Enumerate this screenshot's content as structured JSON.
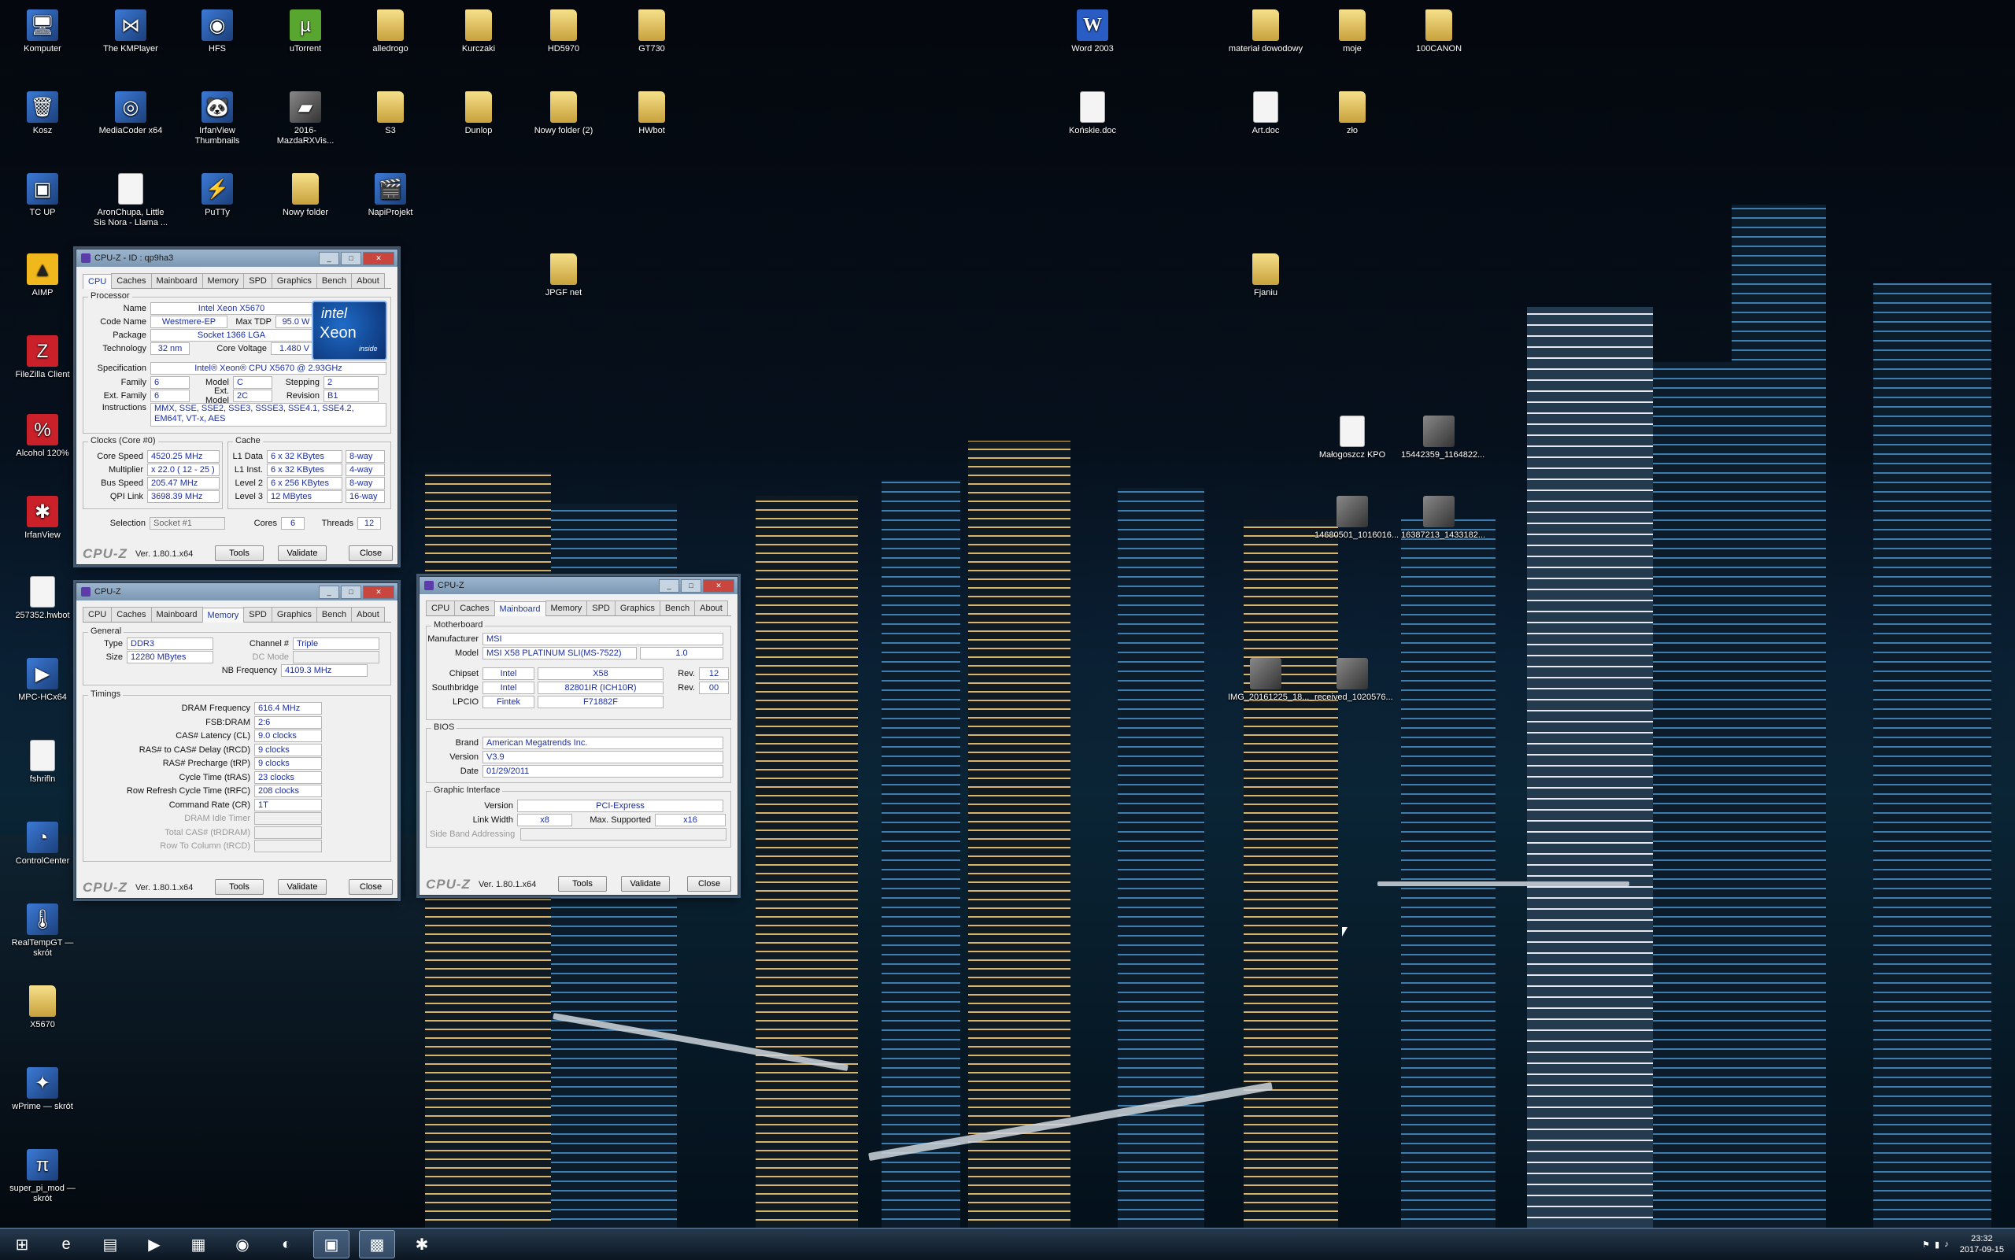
{
  "desktop_icons": [
    {
      "label": "Komputer",
      "icon": "computer-icon",
      "glyph": "🖥"
    },
    {
      "label": "The KMPlayer",
      "icon": "kmplayer-icon",
      "glyph": "⋈"
    },
    {
      "label": "HFS",
      "icon": "hfs-icon",
      "glyph": "◉"
    },
    {
      "label": "uTorrent",
      "icon": "utorrent-icon",
      "glyph": "µ"
    },
    {
      "label": "alledrogo",
      "icon": "folder-icon",
      "glyph": ""
    },
    {
      "label": "Kurczaki",
      "icon": "folder-icon",
      "glyph": ""
    },
    {
      "label": "HD5970",
      "icon": "folder-icon",
      "glyph": ""
    },
    {
      "label": "GT730",
      "icon": "folder-icon",
      "glyph": ""
    },
    {
      "label": "Word 2003",
      "icon": "word-icon",
      "glyph": "W"
    },
    {
      "label": "materiał dowodowy",
      "icon": "folder-icon",
      "glyph": ""
    },
    {
      "label": "moje",
      "icon": "folder-icon",
      "glyph": ""
    },
    {
      "label": "100CANON",
      "icon": "folder-icon",
      "glyph": ""
    },
    {
      "label": "Kosz",
      "icon": "recycle-bin-icon",
      "glyph": "🗑"
    },
    {
      "label": "MediaCoder x64",
      "icon": "mediacoder-icon",
      "glyph": "◎"
    },
    {
      "label": "IrfanView Thumbnails",
      "icon": "irfanview-thumbs-icon",
      "glyph": "🐼"
    },
    {
      "label": "2016-MazdaRXVis...",
      "icon": "image-icon",
      "glyph": "▰"
    },
    {
      "label": "S3",
      "icon": "folder-icon",
      "glyph": ""
    },
    {
      "label": "Dunlop",
      "icon": "folder-icon",
      "glyph": ""
    },
    {
      "label": "Nowy folder (2)",
      "icon": "folder-icon",
      "glyph": ""
    },
    {
      "label": "HWbot",
      "icon": "folder-icon",
      "glyph": ""
    },
    {
      "label": "Końskie.doc",
      "icon": "document-icon",
      "glyph": ""
    },
    {
      "label": "Art.doc",
      "icon": "document-icon",
      "glyph": ""
    },
    {
      "label": "zło",
      "icon": "folder-icon",
      "glyph": ""
    },
    {
      "label": "TC UP",
      "icon": "tcup-icon",
      "glyph": "▣"
    },
    {
      "label": "AronChupa, Little Sis Nora - Llama ...",
      "icon": "document-icon",
      "glyph": ""
    },
    {
      "label": "PuTTy",
      "icon": "putty-icon",
      "glyph": "⚡"
    },
    {
      "label": "Nowy folder",
      "icon": "folder-icon",
      "glyph": ""
    },
    {
      "label": "NapiProjekt",
      "icon": "napiprojekt-icon",
      "glyph": "🎬"
    },
    {
      "label": "AIMP",
      "icon": "aimp-icon",
      "glyph": "▲"
    },
    {
      "label": "JPGF net",
      "icon": "folder-icon",
      "glyph": ""
    },
    {
      "label": "Fjaniu",
      "icon": "folder-icon",
      "glyph": ""
    },
    {
      "label": "FileZilla Client",
      "icon": "filezilla-icon",
      "glyph": "Z"
    },
    {
      "label": "Alcohol 120%",
      "icon": "alcohol-icon",
      "glyph": "%"
    },
    {
      "label": "Małogoszcz KPO",
      "icon": "document-icon",
      "glyph": ""
    },
    {
      "label": "15442359_1164822...",
      "icon": "image-icon",
      "glyph": ""
    },
    {
      "label": "IrfanView",
      "icon": "irfanview-icon",
      "glyph": "✱"
    },
    {
      "label": "14680501_1016016...",
      "icon": "image-icon",
      "glyph": ""
    },
    {
      "label": "16387213_1433182...",
      "icon": "image-icon",
      "glyph": ""
    },
    {
      "label": "257352.hwbot",
      "icon": "document-icon",
      "glyph": ""
    },
    {
      "label": "MPC-HCx64",
      "icon": "mpchc-icon",
      "glyph": "▶"
    },
    {
      "label": "IMG_20161225_18...",
      "icon": "image-icon",
      "glyph": ""
    },
    {
      "label": "received_1020576...",
      "icon": "image-icon",
      "glyph": ""
    },
    {
      "label": "fshrifln",
      "icon": "document-icon",
      "glyph": ""
    },
    {
      "label": "ControlCenter",
      "icon": "controlcenter-icon",
      "glyph": "◔"
    },
    {
      "label": "RealTempGT — skrót",
      "icon": "realtemp-icon",
      "glyph": "🌡"
    },
    {
      "label": "X5670",
      "icon": "folder-icon",
      "glyph": ""
    },
    {
      "label": "wPrime — skrót",
      "icon": "wprime-icon",
      "glyph": "✦"
    },
    {
      "label": "super_pi_mod — skrót",
      "icon": "superpi-icon",
      "glyph": "π"
    }
  ],
  "cpu_window": {
    "title": "CPU-Z - ID : qp9ha3",
    "tabs": [
      "CPU",
      "Caches",
      "Mainboard",
      "Memory",
      "SPD",
      "Graphics",
      "Bench",
      "About"
    ],
    "processor_group": "Processor",
    "name_label": "Name",
    "name": "Intel Xeon X5670",
    "code_name_label": "Code Name",
    "code_name": "Westmere-EP",
    "max_tdp_label": "Max TDP",
    "max_tdp": "95.0 W",
    "package_label": "Package",
    "package": "Socket 1366 LGA",
    "technology_label": "Technology",
    "technology": "32 nm",
    "core_voltage_label": "Core Voltage",
    "core_voltage": "1.480 V",
    "specification_label": "Specification",
    "specification": "Intel® Xeon® CPU       X5670  @ 2.93GHz",
    "family_label": "Family",
    "family": "6",
    "model_label": "Model",
    "model": "C",
    "stepping_label": "Stepping",
    "stepping": "2",
    "ext_family_label": "Ext. Family",
    "ext_family": "6",
    "ext_model_label": "Ext. Model",
    "ext_model": "2C",
    "revision_label": "Revision",
    "revision": "B1",
    "instructions_label": "Instructions",
    "instructions": "MMX, SSE, SSE2, SSE3, SSSE3, SSE4.1, SSE4.2, EM64T, VT-x, AES",
    "clocks_group": "Clocks (Core #0)",
    "core_speed_label": "Core Speed",
    "core_speed": "4520.25 MHz",
    "multiplier_label": "Multiplier",
    "multiplier": "x 22.0 ( 12 - 25 )",
    "bus_speed_label": "Bus Speed",
    "bus_speed": "205.47 MHz",
    "qpi_link_label": "QPI Link",
    "qpi_link": "3698.39 MHz",
    "cache_group": "Cache",
    "l1d_label": "L1 Data",
    "l1d": "6 x 32 KBytes",
    "l1d_way": "8-way",
    "l1i_label": "L1 Inst.",
    "l1i": "6 x 32 KBytes",
    "l1i_way": "4-way",
    "l2_label": "Level 2",
    "l2": "6 x 256 KBytes",
    "l2_way": "8-way",
    "l3_label": "Level 3",
    "l3": "12 MBytes",
    "l3_way": "16-way",
    "selection_label": "Selection",
    "selection": "Socket #1",
    "cores_label": "Cores",
    "cores": "6",
    "threads_label": "Threads",
    "threads": "12",
    "badge_brand": "intel",
    "badge_product": "Xeon",
    "badge_inside": "inside"
  },
  "memory_window": {
    "title": "CPU-Z",
    "tabs": [
      "CPU",
      "Caches",
      "Mainboard",
      "Memory",
      "SPD",
      "Graphics",
      "Bench",
      "About"
    ],
    "general_group": "General",
    "type_label": "Type",
    "type": "DDR3",
    "channel_label": "Channel #",
    "channel": "Triple",
    "size_label": "Size",
    "size": "12280 MBytes",
    "dc_mode_label": "DC Mode",
    "dc_mode": "",
    "nb_freq_label": "NB Frequency",
    "nb_freq": "4109.3 MHz",
    "timings_group": "Timings",
    "timings": [
      {
        "label": "DRAM Frequency",
        "value": "616.4 MHz",
        "disabled": false
      },
      {
        "label": "FSB:DRAM",
        "value": "2:6",
        "disabled": false
      },
      {
        "label": "CAS# Latency (CL)",
        "value": "9.0 clocks",
        "disabled": false
      },
      {
        "label": "RAS# to CAS# Delay (tRCD)",
        "value": "9 clocks",
        "disabled": false
      },
      {
        "label": "RAS# Precharge (tRP)",
        "value": "9 clocks",
        "disabled": false
      },
      {
        "label": "Cycle Time (tRAS)",
        "value": "23 clocks",
        "disabled": false
      },
      {
        "label": "Row Refresh Cycle Time (tRFC)",
        "value": "208 clocks",
        "disabled": false
      },
      {
        "label": "Command Rate (CR)",
        "value": "1T",
        "disabled": false
      },
      {
        "label": "DRAM Idle Timer",
        "value": "",
        "disabled": true
      },
      {
        "label": "Total CAS# (tRDRAM)",
        "value": "",
        "disabled": true
      },
      {
        "label": "Row To Column (tRCD)",
        "value": "",
        "disabled": true
      }
    ]
  },
  "mainboard_window": {
    "title": "CPU-Z",
    "tabs": [
      "CPU",
      "Caches",
      "Mainboard",
      "Memory",
      "SPD",
      "Graphics",
      "Bench",
      "About"
    ],
    "motherboard_group": "Motherboard",
    "manufacturer_label": "Manufacturer",
    "manufacturer": "MSI",
    "model_label": "Model",
    "model": "MSI X58 PLATINUM SLI(MS-7522)",
    "model_rev": "1.0",
    "chipset_label": "Chipset",
    "chipset_vendor": "Intel",
    "chipset": "X58",
    "chipset_rev_label": "Rev.",
    "chipset_rev": "12",
    "southbridge_label": "Southbridge",
    "southbridge_vendor": "Intel",
    "southbridge": "82801IR (ICH10R)",
    "southbridge_rev_label": "Rev.",
    "southbridge_rev": "00",
    "lpcio_label": "LPCIO",
    "lpcio_vendor": "Fintek",
    "lpcio": "F71882F",
    "bios_group": "BIOS",
    "brand_label": "Brand",
    "brand": "American Megatrends Inc.",
    "version_label": "Version",
    "version": "V3.9",
    "date_label": "Date",
    "date": "01/29/2011",
    "graphic_group": "Graphic Interface",
    "gi_version_label": "Version",
    "gi_version": "PCI-Express",
    "link_width_label": "Link Width",
    "link_width": "x8",
    "max_supported_label": "Max. Supported",
    "max_supported": "x16",
    "side_band_label": "Side Band Addressing",
    "side_band": ""
  },
  "footer": {
    "brand": "CPU-Z",
    "version": "Ver. 1.80.1.x64",
    "tools": "Tools",
    "validate": "Validate",
    "close": "Close"
  },
  "taskbar": {
    "items": [
      {
        "name": "start-button",
        "glyph": "⊞"
      },
      {
        "name": "internet-explorer-icon",
        "glyph": "e"
      },
      {
        "name": "explorer-icon",
        "glyph": "▤"
      },
      {
        "name": "media-player-icon",
        "glyph": "▶"
      },
      {
        "name": "device-icon",
        "glyph": "▦"
      },
      {
        "name": "chrome-icon",
        "glyph": "◉"
      },
      {
        "name": "firefox-icon",
        "glyph": "◐"
      },
      {
        "name": "app-green-icon",
        "glyph": "▣"
      },
      {
        "name": "cpuz-taskbar-icon",
        "glyph": "▩"
      },
      {
        "name": "irfanview-taskbar-icon",
        "glyph": "✱"
      }
    ],
    "time": "23:32",
    "date": "2017-09-15"
  }
}
